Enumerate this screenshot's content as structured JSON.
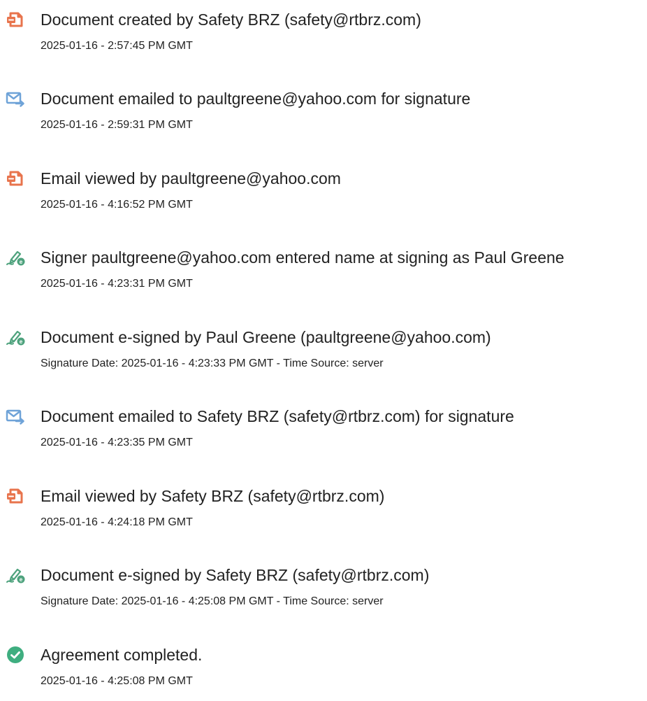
{
  "colors": {
    "document_icon": "#E8744D",
    "email_icon": "#6FA3D8",
    "sign_icon": "#4EA27D",
    "complete_icon": "#3FAE80",
    "text": "#222222"
  },
  "events": [
    {
      "icon": "document-icon",
      "title": "Document created by Safety BRZ (safety@rtbrz.com)",
      "detail": "2025-01-16 - 2:57:45 PM GMT"
    },
    {
      "icon": "email-icon",
      "title": "Document emailed to paultgreene@yahoo.com for signature",
      "detail": "2025-01-16 - 2:59:31 PM GMT"
    },
    {
      "icon": "document-icon",
      "title": "Email viewed by paultgreene@yahoo.com",
      "detail": "2025-01-16 - 4:16:52 PM GMT"
    },
    {
      "icon": "sign-icon",
      "title": "Signer paultgreene@yahoo.com entered name at signing as Paul Greene",
      "detail": "2025-01-16 - 4:23:31 PM GMT"
    },
    {
      "icon": "sign-icon",
      "title": "Document e-signed by Paul Greene (paultgreene@yahoo.com)",
      "detail": "Signature Date: 2025-01-16 - 4:23:33 PM GMT - Time Source: server"
    },
    {
      "icon": "email-icon",
      "title": "Document emailed to Safety BRZ (safety@rtbrz.com) for signature",
      "detail": "2025-01-16 - 4:23:35 PM GMT"
    },
    {
      "icon": "document-icon",
      "title": "Email viewed by Safety BRZ (safety@rtbrz.com)",
      "detail": "2025-01-16 - 4:24:18 PM GMT"
    },
    {
      "icon": "sign-icon",
      "title": "Document e-signed by Safety BRZ (safety@rtbrz.com)",
      "detail": "Signature Date: 2025-01-16 - 4:25:08 PM GMT - Time Source: server"
    },
    {
      "icon": "complete-icon",
      "title": "Agreement completed.",
      "detail": "2025-01-16 - 4:25:08 PM GMT"
    }
  ]
}
